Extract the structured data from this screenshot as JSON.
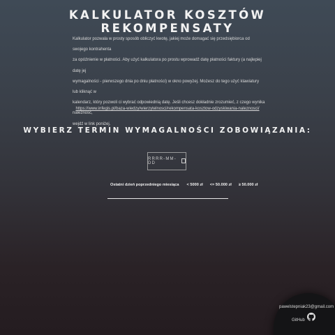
{
  "header": {
    "title": "KALKULATOR KOSZTÓW REKOMPENSATY"
  },
  "intro": {
    "lines": [
      "Kalkulator pozwala w prosty sposób obliczyć kwotę, jakiej może domagać się przedsiębiorca od swojego kontrahenta",
      "za opóźnienie w płatności. Aby użyć kalkulatora po prostu wprowadź datę płatności faktury (a najlepiej datę jej",
      "wymagalności - pierwszego dnia po dniu płatności) w okno powyżej. Możesz do tego użyć klawiatury lub kliknąć w",
      "kalendarz, który pozwoli ci wybrać odpowiednią datę. Jeśli chcesz dokładnie zrozumieć, z czego wynika należność,",
      "wejdź w link poniżej."
    ],
    "link": "https://www.infegis.pl/baza-wiedzy/wierzytelnosci/rekompensata-kosztow-odzyskiwania-naleznosci/"
  },
  "form": {
    "heading": "WYBIERZ TERMIN WYMAGALNOŚCI ZOBOWIĄZANIA:",
    "date_placeholder": "RRRR-MM-DD"
  },
  "table": {
    "headers": [
      "Ostatni dzień poprzedniego miesiąca",
      "< 5000 zł",
      "<= 50.000 zł",
      "≥ 50.000 zł"
    ]
  },
  "footer": {
    "email": "pawelstepniak23@gmail.com",
    "github_label": "GitHub",
    "github_icon": "github-icon"
  }
}
